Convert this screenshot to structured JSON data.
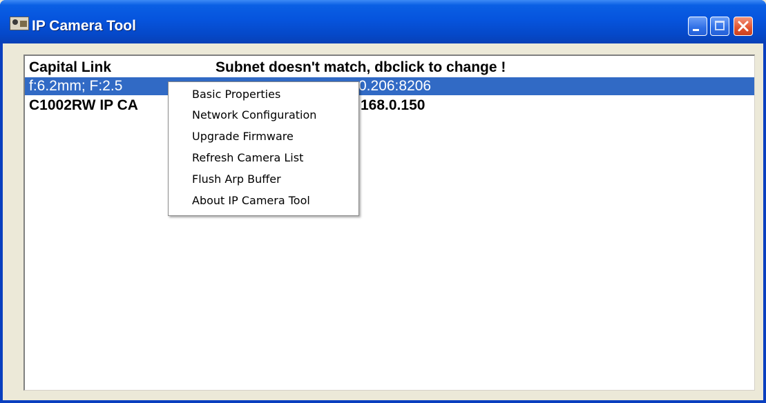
{
  "window": {
    "title": "IP Camera Tool",
    "icon": "ip-camera-tool-app-icon",
    "controls": [
      "minimize-icon",
      "maximize-icon",
      "close-icon"
    ]
  },
  "camera_list": {
    "rows": [
      {
        "name": "Capital Link",
        "info": "Subnet doesn't match, dbclick to change !",
        "selected": false
      },
      {
        "name": "f:6.2mm; F:2.5",
        "info": "0.206:8206",
        "selected": true
      },
      {
        "name": "C1002RW IP CA",
        "info": "168.0.150",
        "selected": false
      }
    ]
  },
  "context_menu": {
    "items": [
      "Basic Properties",
      "Network Configuration",
      "Upgrade Firmware",
      "Refresh Camera List",
      "Flush Arp Buffer",
      "About IP Camera Tool"
    ]
  },
  "colors": {
    "title_bar": "#0654dd",
    "selection": "#316ac5",
    "close_button": "#e2542f",
    "window_face": "#ece9d8"
  }
}
